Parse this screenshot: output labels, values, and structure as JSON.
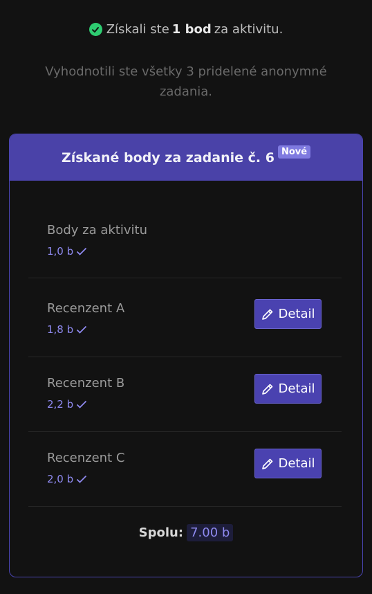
{
  "message": {
    "prefix": "Získali ste",
    "bold": "1 bod",
    "suffix": "za aktivitu.",
    "sub": "Vyhodnotili ste všetky 3 pridelené anonymné zadania."
  },
  "card": {
    "title": "Získané body za zadanie č. 6",
    "badge": "Nové",
    "rows": [
      {
        "label": "Body za aktivitu",
        "points": "1,0 b",
        "detail": ""
      },
      {
        "label": "Recenzent A",
        "points": "1,8 b",
        "detail": "Detail"
      },
      {
        "label": "Recenzent B",
        "points": "2,2 b",
        "detail": "Detail"
      },
      {
        "label": "Recenzent C",
        "points": "2,0 b",
        "detail": "Detail"
      }
    ],
    "total_label": "Spolu:",
    "total_value": "7.00 b"
  },
  "colors": {
    "accent": "#4a42a8",
    "points": "#8f8af0",
    "success": "#2ecc71"
  }
}
